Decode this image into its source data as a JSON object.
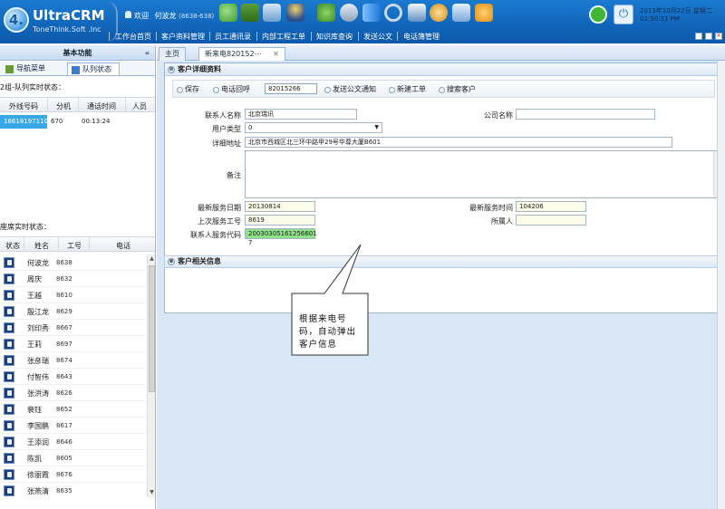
{
  "header": {
    "logo_mark": "4.",
    "app_name": "UltraCRM",
    "company": "ToneThink.Soft .Inc",
    "welcome": "欢迎",
    "user_name": "何波龙",
    "user_ext": "(8638-638)",
    "date": "2013年10月22日 星期二",
    "time": "02:50:31 PM",
    "toolbar_icons": [
      "users-icon",
      "folder-icon",
      "monitor-icon",
      "agent-icon",
      "transfer-icon",
      "phone-icon",
      "forward-icon",
      "headset-icon",
      "screen-icon",
      "settings-icon",
      "network-icon",
      "thumbs-up-icon"
    ]
  },
  "nav": {
    "items": [
      "工作台首页",
      "客户资料管理",
      "员工通讯录",
      "内部工程工单",
      "知识库查询",
      "发送公文",
      "电话簿管理"
    ]
  },
  "left": {
    "title": "基本功能",
    "collapse": "«",
    "tabs": [
      "导航菜单",
      "队列状态"
    ],
    "queue_section": "2组-队列实时状态：",
    "queue_headers": [
      "外线号码",
      "分机",
      "通话时间",
      "人员"
    ],
    "queue_row": {
      "number": "18618197110",
      "ext": "670",
      "duration": "00:13:24",
      "person": ""
    },
    "agent_section": "座席实时状态：",
    "agent_headers": [
      "状态",
      "姓名",
      "工号",
      "电话"
    ],
    "agents": [
      {
        "name": "何波龙",
        "id": "8638"
      },
      {
        "name": "周庆",
        "id": "8632"
      },
      {
        "name": "王越",
        "id": "8610"
      },
      {
        "name": "殷江龙",
        "id": "8629"
      },
      {
        "name": "刘印秀",
        "id": "8667"
      },
      {
        "name": "王莉",
        "id": "8697"
      },
      {
        "name": "张彦瑞",
        "id": "8674"
      },
      {
        "name": "付智伟",
        "id": "8643"
      },
      {
        "name": "张洪涛",
        "id": "8626"
      },
      {
        "name": "裴钰",
        "id": "8652"
      },
      {
        "name": "李国鹏",
        "id": "8617"
      },
      {
        "name": "王添润",
        "id": "8646"
      },
      {
        "name": "陈凯",
        "id": "8605"
      },
      {
        "name": "徐丽霞",
        "id": "8676"
      },
      {
        "name": "张燕清",
        "id": "8635"
      }
    ]
  },
  "main": {
    "tabs": [
      {
        "label": "主页"
      },
      {
        "label": "新来电820152⋯",
        "close": "✕"
      }
    ],
    "panel_title": "客户详细资料",
    "toggle_symbol": "⊗",
    "toolbar": {
      "save": "保存",
      "call": "电话回呼",
      "call_number": "82015266",
      "notice": "发送公文通知",
      "new_ticket": "新建工单",
      "search": "搜索客户"
    },
    "form": {
      "contact_name_label": "联系人名称",
      "contact_name": "北京瑞讯",
      "company_label": "公司名称",
      "company": "",
      "user_type_label": "用户类型",
      "user_type": "0",
      "address_label": "详细地址",
      "address": "北京市西城区北三环中路甲29号华尊大厦B601",
      "remark_label": "备注",
      "last_date_label": "最新服务日期",
      "last_date": "20130814",
      "last_time_label": "最新服务时间",
      "last_time": "104206",
      "prev_id_label": "上次服务工号",
      "prev_id": "8619",
      "owner_label": "所属人",
      "owner": "",
      "service_code_label": "联系人服务代码",
      "service_code": "20030305161256601 7"
    },
    "related_title": "客户相关信息"
  },
  "callout": {
    "text": "根据来电号码，自动弹出客户信息"
  }
}
